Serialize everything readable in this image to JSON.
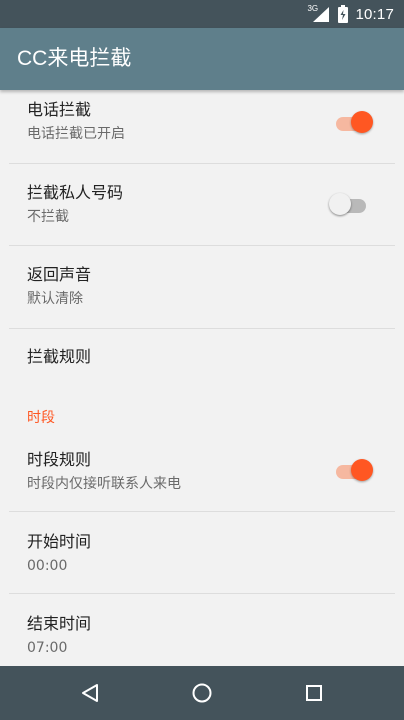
{
  "status_bar": {
    "network": "3G",
    "time": "10:17",
    "icons": [
      "signal-icon",
      "battery-icon"
    ]
  },
  "app_bar": {
    "title": "CC来电拦截"
  },
  "settings": {
    "call_block": {
      "title": "电话拦截",
      "summary": "电话拦截已开启",
      "enabled": true
    },
    "private_numbers": {
      "title": "拦截私人号码",
      "summary": "不拦截",
      "enabled": false
    },
    "return_sound": {
      "title": "返回声音",
      "summary": "默认清除"
    },
    "block_rules": {
      "title": "拦截规则"
    },
    "time_section": {
      "header": "时段"
    },
    "time_rules": {
      "title": "时段规则",
      "summary": "时段内仅接听联系人来电",
      "enabled": true
    },
    "start_time": {
      "title": "开始时间",
      "summary": "00:00"
    },
    "end_time": {
      "title": "结束时间",
      "summary": "07:00"
    }
  },
  "colors": {
    "status_bar": "#44535b",
    "app_bar": "#5f7f8b",
    "accent": "#ff5722",
    "background": "#f2f2f2"
  },
  "nav_bar": {
    "buttons": [
      "back-icon",
      "home-icon",
      "recents-icon"
    ]
  }
}
